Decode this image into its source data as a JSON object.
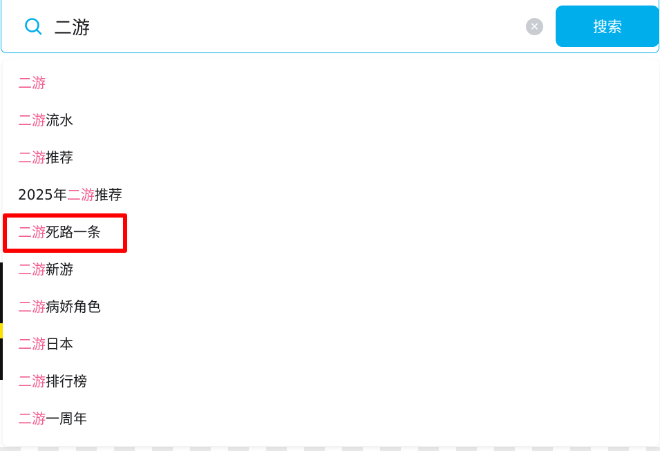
{
  "search": {
    "query": "二游",
    "button_label": "搜索",
    "clear_glyph": "✕"
  },
  "suggestions": [
    {
      "prefix": "",
      "match": "二游",
      "suffix": ""
    },
    {
      "prefix": "",
      "match": "二游",
      "suffix": "流水"
    },
    {
      "prefix": "",
      "match": "二游",
      "suffix": "推荐"
    },
    {
      "prefix": "2025年",
      "match": "二游",
      "suffix": "推荐"
    },
    {
      "prefix": "",
      "match": "二游",
      "suffix": "死路一条"
    },
    {
      "prefix": "",
      "match": "二游",
      "suffix": "新游"
    },
    {
      "prefix": "",
      "match": "二游",
      "suffix": "病娇角色"
    },
    {
      "prefix": "",
      "match": "二游",
      "suffix": "日本"
    },
    {
      "prefix": "",
      "match": "二游",
      "suffix": "排行榜"
    },
    {
      "prefix": "",
      "match": "二游",
      "suffix": "一周年"
    }
  ],
  "highlighted_index": 4,
  "colors": {
    "accent": "#00aeec",
    "match_highlight": "#f25d8e",
    "annotation_box": "#ff0000"
  }
}
